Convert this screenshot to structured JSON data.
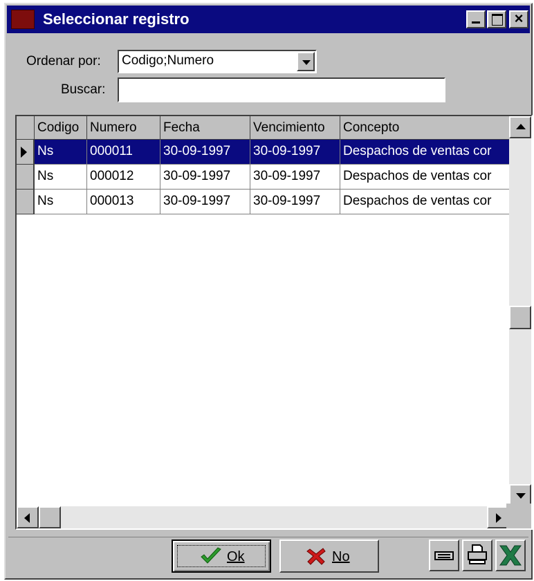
{
  "window": {
    "title": "Seleccionar registro"
  },
  "form": {
    "order_label": "Ordenar por:",
    "order_value": "Codigo;Numero",
    "search_label": "Buscar:",
    "search_value": ""
  },
  "grid": {
    "columns": [
      "Codigo",
      "Numero",
      "Fecha",
      "Vencimiento",
      "Concepto"
    ],
    "rows": [
      [
        "Ns",
        "000011",
        "30-09-1997",
        "30-09-1997",
        "Despachos de ventas cor"
      ],
      [
        "Ns",
        "000012",
        "30-09-1997",
        "30-09-1997",
        "Despachos de ventas cor"
      ],
      [
        "Ns",
        "000013",
        "30-09-1997",
        "30-09-1997",
        "Despachos de ventas cor"
      ]
    ],
    "selected_row": 0
  },
  "buttons": {
    "ok_label": "Ok",
    "no_label": "No"
  },
  "icons": [
    "keyboard-icon",
    "printer-icon",
    "excel-icon"
  ],
  "colors": {
    "titlebar": "#0a0a80",
    "selection": "#0a0a80",
    "face": "#c0c0c0"
  }
}
